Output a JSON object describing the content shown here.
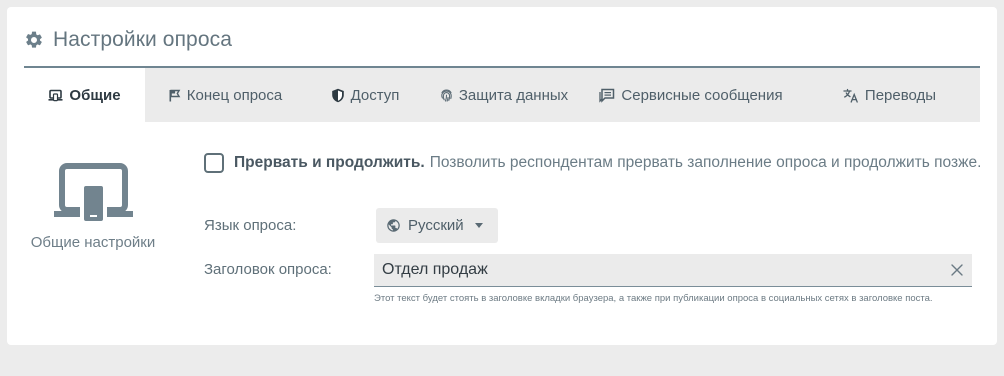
{
  "header": {
    "title": "Настройки опроса",
    "icon": "gear-icon"
  },
  "tabs": [
    {
      "label": "Общие",
      "icon": "laptop-device-icon",
      "active": true
    },
    {
      "label": "Конец опроса",
      "icon": "flag-icon",
      "active": false
    },
    {
      "label": "Доступ",
      "icon": "shield-icon",
      "active": false
    },
    {
      "label": "Защита данных",
      "icon": "fingerprint-icon",
      "active": false
    },
    {
      "label": "Сервисные сообщения",
      "icon": "message-icon",
      "active": false
    },
    {
      "label": "Переводы",
      "icon": "translate-icon",
      "active": false
    }
  ],
  "section": {
    "label": "Общие настройки",
    "icon": "laptop-device-icon"
  },
  "pause_option": {
    "checked": false,
    "title": "Прервать и продолжить.",
    "description": "Позволить респондентам прервать заполнение опроса и продолжить позже."
  },
  "language": {
    "label": "Язык опроса:",
    "value": "Русский",
    "icon": "globe-icon"
  },
  "survey_title": {
    "label": "Заголовок опроса:",
    "value": "Отдел продаж",
    "hint": "Этот текст будет стоять в заголовке вкладки браузера, а также при публикации опроса в социальных сетях в заголовке поста."
  },
  "colors": {
    "accent": "#6f8591",
    "tab_bg": "#ebebeb",
    "page_bg": "#ececec"
  }
}
